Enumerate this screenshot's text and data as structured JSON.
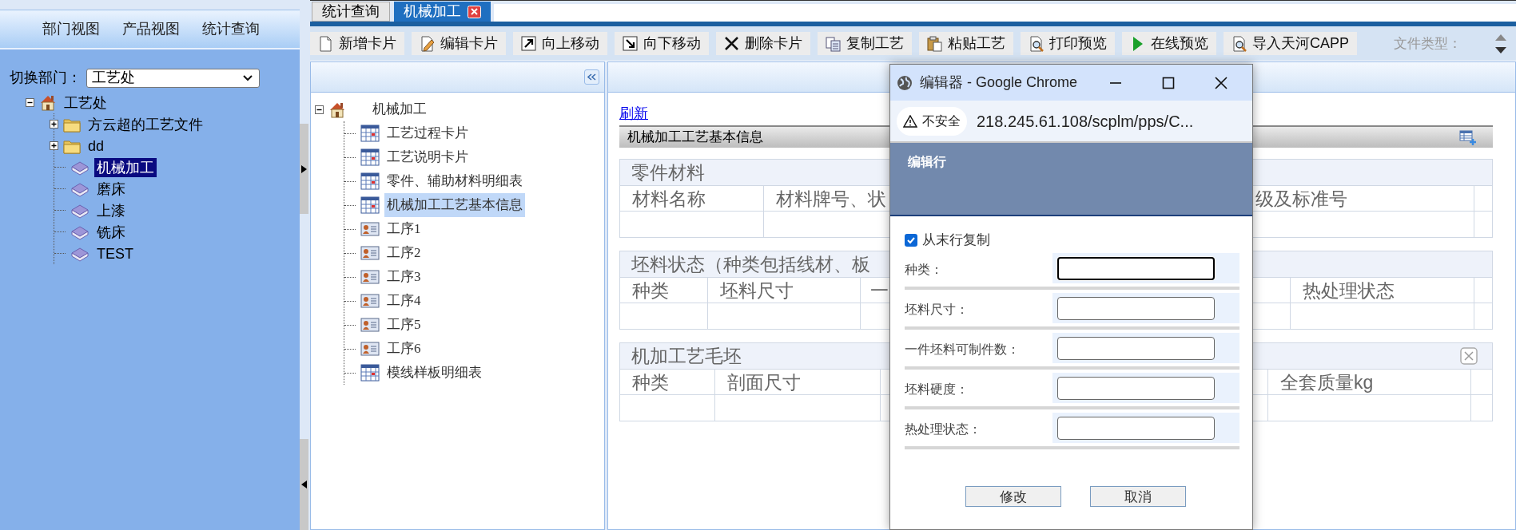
{
  "sidebar": {
    "nav_tabs": [
      {
        "label": "部门视图"
      },
      {
        "label": "产品视图"
      },
      {
        "label": "统计查询"
      }
    ],
    "department_label": "切换部门：",
    "department_select": {
      "value": "工艺处"
    },
    "tree": [
      {
        "label": "工艺处",
        "kind": "home",
        "expanded": true,
        "selected": false,
        "children": [
          {
            "label": "方云超的工艺文件",
            "kind": "folder",
            "expanded": false,
            "selected": false
          },
          {
            "label": "dd",
            "kind": "folder",
            "expanded": false,
            "selected": false
          },
          {
            "label": "机械加工",
            "kind": "book",
            "selected": true
          },
          {
            "label": "磨床",
            "kind": "book",
            "selected": false
          },
          {
            "label": "上漆",
            "kind": "book",
            "selected": false
          },
          {
            "label": "铣床",
            "kind": "book",
            "selected": false
          },
          {
            "label": "TEST",
            "kind": "book",
            "selected": false
          }
        ]
      }
    ]
  },
  "tabs": [
    {
      "label": "统计查询",
      "selected": false,
      "closable": false
    },
    {
      "label": "机械加工",
      "selected": true,
      "closable": true
    }
  ],
  "toolbar": {
    "buttons": [
      {
        "label": "新增卡片",
        "kind": "page"
      },
      {
        "label": "编辑卡片",
        "kind": "edit"
      },
      {
        "label": "向上移动",
        "kind": "up"
      },
      {
        "label": "向下移动",
        "kind": "down"
      },
      {
        "label": "删除卡片",
        "kind": "delete"
      },
      {
        "label": "复制工艺",
        "kind": "copy"
      },
      {
        "label": "粘贴工艺",
        "kind": "paste"
      },
      {
        "label": "打印预览",
        "kind": "preview"
      },
      {
        "label": "在线预览",
        "kind": "play"
      },
      {
        "label": "导入天河CAPP",
        "kind": "preview"
      }
    ],
    "file_type_label": "文件类型："
  },
  "left_pane": {
    "tree": [
      {
        "label": "机械加工",
        "kind": "home",
        "expanded": true,
        "selected": false,
        "children": [
          {
            "label": "工艺过程卡片",
            "kind": "table",
            "selected": false
          },
          {
            "label": "工艺说明卡片",
            "kind": "table",
            "selected": false
          },
          {
            "label": "零件、辅助材料明细表",
            "kind": "table",
            "selected": false
          },
          {
            "label": "机械加工工艺基本信息",
            "kind": "table",
            "selected": true
          },
          {
            "label": "工序1",
            "kind": "card",
            "selected": false
          },
          {
            "label": "工序2",
            "kind": "card",
            "selected": false
          },
          {
            "label": "工序3",
            "kind": "card",
            "selected": false
          },
          {
            "label": "工序4",
            "kind": "card",
            "selected": false
          },
          {
            "label": "工序5",
            "kind": "card",
            "selected": false
          },
          {
            "label": "工序6",
            "kind": "card",
            "selected": false
          },
          {
            "label": "模线样板明细表",
            "kind": "table",
            "selected": false
          }
        ]
      }
    ]
  },
  "content": {
    "refresh_link": "刷新",
    "section_bar": {
      "title": "机械加工工艺基本信息"
    },
    "sections": [
      {
        "title": "零件材料",
        "closable": false,
        "columns": [
          "材料名称",
          "材料牌号、状",
          "级及标准号"
        ]
      },
      {
        "title": "坯料状态（种类包括线材、板",
        "closable": false,
        "columns": [
          "种类",
          "坯料尺寸",
          "一",
          "热处理状态"
        ]
      },
      {
        "title": "机加工艺毛坯",
        "closable": true,
        "columns": [
          "种类",
          "剖面尺寸",
          "全套质量kg"
        ]
      }
    ]
  },
  "dialog": {
    "window_title": "编辑器 - Google Chrome",
    "security_label": "不安全",
    "url": "218.245.61.108/scplm/pps/C...",
    "header": "编辑行",
    "copy_from_last_row": {
      "label": "从末行复制",
      "checked": true
    },
    "fields": [
      {
        "label": "种类：",
        "focused": true
      },
      {
        "label": "坯料尺寸：",
        "focused": false
      },
      {
        "label": "一件坯料可制件数：",
        "focused": false
      },
      {
        "label": "坯料硬度：",
        "focused": false
      },
      {
        "label": "热处理状态：",
        "focused": false
      }
    ],
    "buttons": [
      {
        "label": "修改"
      },
      {
        "label": "取消"
      }
    ]
  }
}
